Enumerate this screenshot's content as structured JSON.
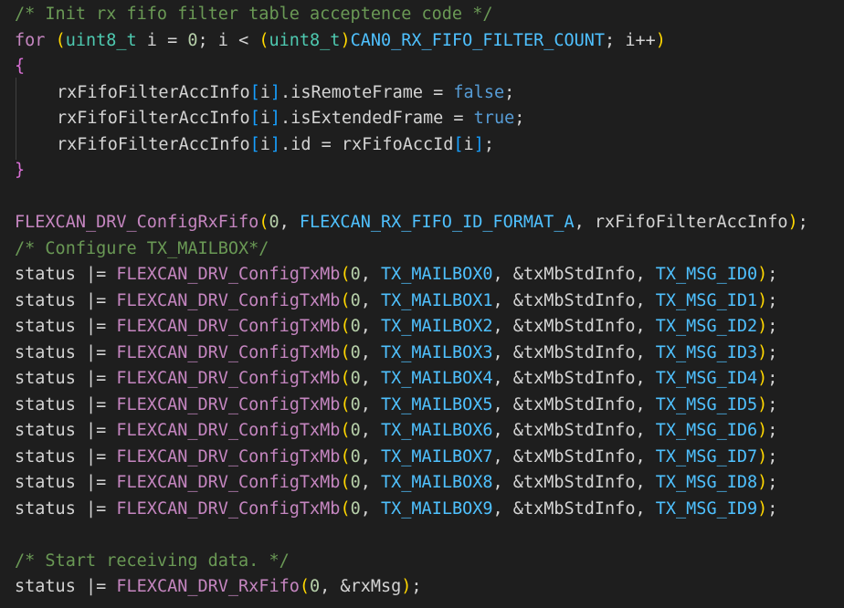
{
  "editor": {
    "theme_colors": {
      "background": "#1e1e1e",
      "comment": "#6a9955",
      "keyword": "#569cd6",
      "function": "#c586c0",
      "macro": "#4fc1ff",
      "number": "#b5cea8",
      "type": "#4ec9b0"
    },
    "lines": [
      {
        "id": "l1",
        "tokens": [
          {
            "t": "/* Init rx fifo filter table acceptence code */",
            "c": "comment"
          }
        ]
      },
      {
        "id": "l2",
        "tokens": [
          {
            "t": "for",
            "c": "ctrl"
          },
          {
            "t": " ",
            "c": "plain"
          },
          {
            "t": "(",
            "c": "paren"
          },
          {
            "t": "uint8_t",
            "c": "type"
          },
          {
            "t": " i = ",
            "c": "plain"
          },
          {
            "t": "0",
            "c": "num"
          },
          {
            "t": "; i < ",
            "c": "plain"
          },
          {
            "t": "(",
            "c": "paren"
          },
          {
            "t": "uint8_t",
            "c": "type"
          },
          {
            "t": ")",
            "c": "paren"
          },
          {
            "t": "CAN0_RX_FIFO_FILTER_COUNT",
            "c": "macro"
          },
          {
            "t": "; i++",
            "c": "plain"
          },
          {
            "t": ")",
            "c": "paren"
          }
        ]
      },
      {
        "id": "l3",
        "tokens": [
          {
            "t": "{",
            "c": "brace"
          }
        ]
      },
      {
        "id": "l4",
        "indent": true,
        "tokens": [
          {
            "t": "rxFifoFilterAccInfo",
            "c": "plain"
          },
          {
            "t": "[",
            "c": "brk"
          },
          {
            "t": "i",
            "c": "plain"
          },
          {
            "t": "]",
            "c": "brk"
          },
          {
            "t": ".isRemoteFrame = ",
            "c": "plain"
          },
          {
            "t": "false",
            "c": "kw"
          },
          {
            "t": ";",
            "c": "plain"
          }
        ]
      },
      {
        "id": "l5",
        "indent": true,
        "tokens": [
          {
            "t": "rxFifoFilterAccInfo",
            "c": "plain"
          },
          {
            "t": "[",
            "c": "brk"
          },
          {
            "t": "i",
            "c": "plain"
          },
          {
            "t": "]",
            "c": "brk"
          },
          {
            "t": ".isExtendedFrame = ",
            "c": "plain"
          },
          {
            "t": "true",
            "c": "kw"
          },
          {
            "t": ";",
            "c": "plain"
          }
        ]
      },
      {
        "id": "l6",
        "indent": true,
        "tokens": [
          {
            "t": "rxFifoFilterAccInfo",
            "c": "plain"
          },
          {
            "t": "[",
            "c": "brk"
          },
          {
            "t": "i",
            "c": "plain"
          },
          {
            "t": "]",
            "c": "brk"
          },
          {
            "t": ".id = rxFifoAccId",
            "c": "plain"
          },
          {
            "t": "[",
            "c": "brk"
          },
          {
            "t": "i",
            "c": "plain"
          },
          {
            "t": "]",
            "c": "brk"
          },
          {
            "t": ";",
            "c": "plain"
          }
        ]
      },
      {
        "id": "l7",
        "tokens": [
          {
            "t": "}",
            "c": "brace"
          }
        ]
      },
      {
        "id": "l8",
        "tokens": []
      },
      {
        "id": "l9",
        "tokens": [
          {
            "t": "FLEXCAN_DRV_ConfigRxFifo",
            "c": "fnp"
          },
          {
            "t": "(",
            "c": "paren"
          },
          {
            "t": "0",
            "c": "num"
          },
          {
            "t": ", ",
            "c": "plain"
          },
          {
            "t": "FLEXCAN_RX_FIFO_ID_FORMAT_A",
            "c": "macro"
          },
          {
            "t": ", rxFifoFilterAccInfo",
            "c": "plain"
          },
          {
            "t": ")",
            "c": "paren"
          },
          {
            "t": ";",
            "c": "plain"
          }
        ]
      },
      {
        "id": "l10",
        "tokens": [
          {
            "t": "/* Configure TX_MAILBOX*/",
            "c": "comment"
          }
        ]
      },
      {
        "id": "l11",
        "tokens": [
          {
            "t": "status |= ",
            "c": "plain"
          },
          {
            "t": "FLEXCAN_DRV_ConfigTxMb",
            "c": "fnp"
          },
          {
            "t": "(",
            "c": "paren"
          },
          {
            "t": "0",
            "c": "num"
          },
          {
            "t": ", ",
            "c": "plain"
          },
          {
            "t": "TX_MAILBOX0",
            "c": "macro"
          },
          {
            "t": ", &txMbStdInfo, ",
            "c": "plain"
          },
          {
            "t": "TX_MSG_ID0",
            "c": "macro"
          },
          {
            "t": ")",
            "c": "paren"
          },
          {
            "t": ";",
            "c": "plain"
          }
        ]
      },
      {
        "id": "l12",
        "tokens": [
          {
            "t": "status |= ",
            "c": "plain"
          },
          {
            "t": "FLEXCAN_DRV_ConfigTxMb",
            "c": "fnp"
          },
          {
            "t": "(",
            "c": "paren"
          },
          {
            "t": "0",
            "c": "num"
          },
          {
            "t": ", ",
            "c": "plain"
          },
          {
            "t": "TX_MAILBOX1",
            "c": "macro"
          },
          {
            "t": ", &txMbStdInfo, ",
            "c": "plain"
          },
          {
            "t": "TX_MSG_ID1",
            "c": "macro"
          },
          {
            "t": ")",
            "c": "paren"
          },
          {
            "t": ";",
            "c": "plain"
          }
        ]
      },
      {
        "id": "l13",
        "tokens": [
          {
            "t": "status |= ",
            "c": "plain"
          },
          {
            "t": "FLEXCAN_DRV_ConfigTxMb",
            "c": "fnp"
          },
          {
            "t": "(",
            "c": "paren"
          },
          {
            "t": "0",
            "c": "num"
          },
          {
            "t": ", ",
            "c": "plain"
          },
          {
            "t": "TX_MAILBOX2",
            "c": "macro"
          },
          {
            "t": ", &txMbStdInfo, ",
            "c": "plain"
          },
          {
            "t": "TX_MSG_ID2",
            "c": "macro"
          },
          {
            "t": ")",
            "c": "paren"
          },
          {
            "t": ";",
            "c": "plain"
          }
        ]
      },
      {
        "id": "l14",
        "tokens": [
          {
            "t": "status |= ",
            "c": "plain"
          },
          {
            "t": "FLEXCAN_DRV_ConfigTxMb",
            "c": "fnp"
          },
          {
            "t": "(",
            "c": "paren"
          },
          {
            "t": "0",
            "c": "num"
          },
          {
            "t": ", ",
            "c": "plain"
          },
          {
            "t": "TX_MAILBOX3",
            "c": "macro"
          },
          {
            "t": ", &txMbStdInfo, ",
            "c": "plain"
          },
          {
            "t": "TX_MSG_ID3",
            "c": "macro"
          },
          {
            "t": ")",
            "c": "paren"
          },
          {
            "t": ";",
            "c": "plain"
          }
        ]
      },
      {
        "id": "l15",
        "tokens": [
          {
            "t": "status |= ",
            "c": "plain"
          },
          {
            "t": "FLEXCAN_DRV_ConfigTxMb",
            "c": "fnp"
          },
          {
            "t": "(",
            "c": "paren"
          },
          {
            "t": "0",
            "c": "num"
          },
          {
            "t": ", ",
            "c": "plain"
          },
          {
            "t": "TX_MAILBOX4",
            "c": "macro"
          },
          {
            "t": ", &txMbStdInfo, ",
            "c": "plain"
          },
          {
            "t": "TX_MSG_ID4",
            "c": "macro"
          },
          {
            "t": ")",
            "c": "paren"
          },
          {
            "t": ";",
            "c": "plain"
          }
        ]
      },
      {
        "id": "l16",
        "tokens": [
          {
            "t": "status |= ",
            "c": "plain"
          },
          {
            "t": "FLEXCAN_DRV_ConfigTxMb",
            "c": "fnp"
          },
          {
            "t": "(",
            "c": "paren"
          },
          {
            "t": "0",
            "c": "num"
          },
          {
            "t": ", ",
            "c": "plain"
          },
          {
            "t": "TX_MAILBOX5",
            "c": "macro"
          },
          {
            "t": ", &txMbStdInfo, ",
            "c": "plain"
          },
          {
            "t": "TX_MSG_ID5",
            "c": "macro"
          },
          {
            "t": ")",
            "c": "paren"
          },
          {
            "t": ";",
            "c": "plain"
          }
        ]
      },
      {
        "id": "l17",
        "tokens": [
          {
            "t": "status |= ",
            "c": "plain"
          },
          {
            "t": "FLEXCAN_DRV_ConfigTxMb",
            "c": "fnp"
          },
          {
            "t": "(",
            "c": "paren"
          },
          {
            "t": "0",
            "c": "num"
          },
          {
            "t": ", ",
            "c": "plain"
          },
          {
            "t": "TX_MAILBOX6",
            "c": "macro"
          },
          {
            "t": ", &txMbStdInfo, ",
            "c": "plain"
          },
          {
            "t": "TX_MSG_ID6",
            "c": "macro"
          },
          {
            "t": ")",
            "c": "paren"
          },
          {
            "t": ";",
            "c": "plain"
          }
        ]
      },
      {
        "id": "l18",
        "tokens": [
          {
            "t": "status |= ",
            "c": "plain"
          },
          {
            "t": "FLEXCAN_DRV_ConfigTxMb",
            "c": "fnp"
          },
          {
            "t": "(",
            "c": "paren"
          },
          {
            "t": "0",
            "c": "num"
          },
          {
            "t": ", ",
            "c": "plain"
          },
          {
            "t": "TX_MAILBOX7",
            "c": "macro"
          },
          {
            "t": ", &txMbStdInfo, ",
            "c": "plain"
          },
          {
            "t": "TX_MSG_ID7",
            "c": "macro"
          },
          {
            "t": ")",
            "c": "paren"
          },
          {
            "t": ";",
            "c": "plain"
          }
        ]
      },
      {
        "id": "l19",
        "tokens": [
          {
            "t": "status |= ",
            "c": "plain"
          },
          {
            "t": "FLEXCAN_DRV_ConfigTxMb",
            "c": "fnp"
          },
          {
            "t": "(",
            "c": "paren"
          },
          {
            "t": "0",
            "c": "num"
          },
          {
            "t": ", ",
            "c": "plain"
          },
          {
            "t": "TX_MAILBOX8",
            "c": "macro"
          },
          {
            "t": ", &txMbStdInfo, ",
            "c": "plain"
          },
          {
            "t": "TX_MSG_ID8",
            "c": "macro"
          },
          {
            "t": ")",
            "c": "paren"
          },
          {
            "t": ";",
            "c": "plain"
          }
        ]
      },
      {
        "id": "l20",
        "tokens": [
          {
            "t": "status |= ",
            "c": "plain"
          },
          {
            "t": "FLEXCAN_DRV_ConfigTxMb",
            "c": "fnp"
          },
          {
            "t": "(",
            "c": "paren"
          },
          {
            "t": "0",
            "c": "num"
          },
          {
            "t": ", ",
            "c": "plain"
          },
          {
            "t": "TX_MAILBOX9",
            "c": "macro"
          },
          {
            "t": ", &txMbStdInfo, ",
            "c": "plain"
          },
          {
            "t": "TX_MSG_ID9",
            "c": "macro"
          },
          {
            "t": ")",
            "c": "paren"
          },
          {
            "t": ";",
            "c": "plain"
          }
        ]
      },
      {
        "id": "l21",
        "tokens": []
      },
      {
        "id": "l22",
        "tokens": [
          {
            "t": "/* Start receiving data. */",
            "c": "comment"
          }
        ]
      },
      {
        "id": "l23",
        "tokens": [
          {
            "t": "status |= ",
            "c": "plain"
          },
          {
            "t": "FLEXCAN_DRV_RxFifo",
            "c": "fnp"
          },
          {
            "t": "(",
            "c": "paren"
          },
          {
            "t": "0",
            "c": "num"
          },
          {
            "t": ", &rxMsg",
            "c": "plain"
          },
          {
            "t": ")",
            "c": "paren"
          },
          {
            "t": ";",
            "c": "plain"
          }
        ]
      }
    ]
  }
}
